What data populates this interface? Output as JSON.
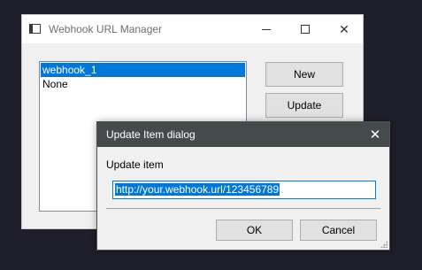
{
  "main_window": {
    "title": "Webhook URL Manager",
    "controls": {
      "minimize_icon": "minimize-icon",
      "maximize_icon": "maximize-icon",
      "close_icon": "close-icon",
      "close_glyph": "✕"
    },
    "list_items": [
      "webhook_1",
      "None"
    ],
    "selected_index": 0,
    "buttons": {
      "new_label": "New",
      "update_label": "Update"
    }
  },
  "dialog": {
    "title": "Update Item dialog",
    "close_glyph": "✕",
    "prompt": "Update item",
    "input_value": "http://your.webhook.url/123456789",
    "buttons": {
      "ok_label": "OK",
      "cancel_label": "Cancel"
    }
  },
  "colors": {
    "desktop_bg": "#1f1e2b",
    "selection": "#0078d7",
    "dialog_titlebar": "#454a4d"
  }
}
